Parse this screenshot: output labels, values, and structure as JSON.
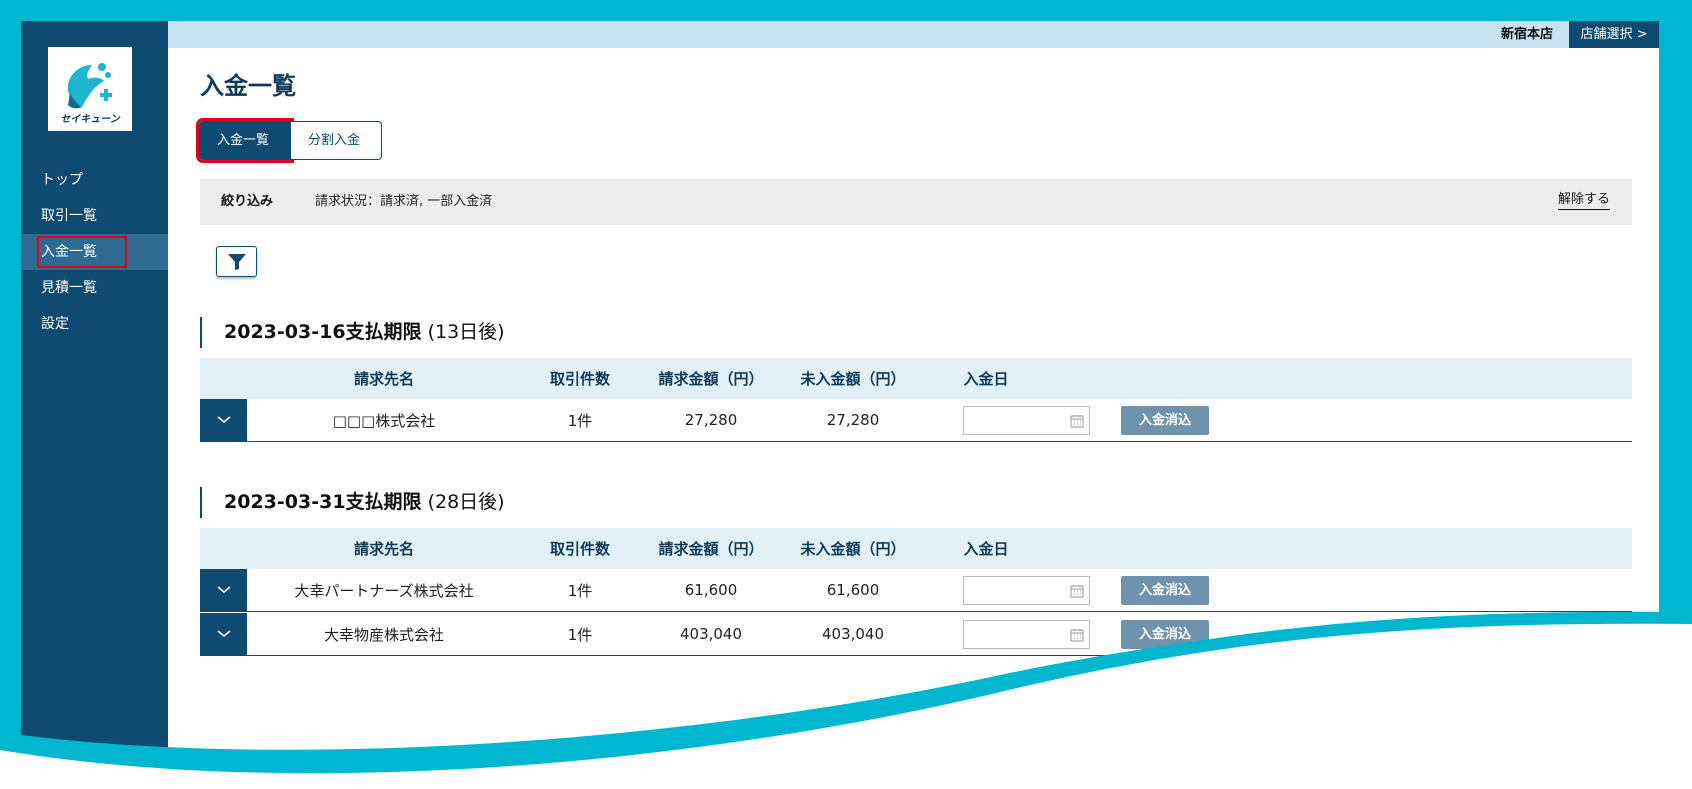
{
  "brand": {
    "logo_text": "セイキューン"
  },
  "header": {
    "store_name": "新宿本店",
    "store_select_label": "店舗選択 >"
  },
  "sidebar": {
    "items": [
      {
        "label": "トップ",
        "active": false
      },
      {
        "label": "取引一覧",
        "active": false
      },
      {
        "label": "入金一覧",
        "active": true
      },
      {
        "label": "見積一覧",
        "active": false
      },
      {
        "label": "設定",
        "active": false
      }
    ]
  },
  "page": {
    "title": "入金一覧"
  },
  "tabs": [
    {
      "label": "入金一覧",
      "active": true
    },
    {
      "label": "分割入金",
      "active": false
    }
  ],
  "filter": {
    "label": "絞り込み",
    "text": "請求状況：請求済, 一部入金済",
    "clear_label": "解除する"
  },
  "table_headers": {
    "name": "請求先名",
    "count": "取引件数",
    "billed": "請求金額（円）",
    "unpaid": "未入金額（円）",
    "date": "入金日"
  },
  "groups": [
    {
      "due": "2023-03-16支払期限",
      "relative": "(13日後)",
      "rows": [
        {
          "name": "□□□株式会社",
          "count": "1件",
          "billed": "27,280",
          "unpaid": "27,280",
          "date": "",
          "action": "入金消込"
        }
      ]
    },
    {
      "due": "2023-03-31支払期限",
      "relative": "(28日後)",
      "rows": [
        {
          "name": "大幸パートナーズ株式会社",
          "count": "1件",
          "billed": "61,600",
          "unpaid": "61,600",
          "date": "",
          "action": "入金消込"
        },
        {
          "name": "大幸物産株式会社",
          "count": "1件",
          "billed": "403,040",
          "unpaid": "403,040",
          "date": "",
          "action": "入金消込"
        }
      ]
    }
  ],
  "colors": {
    "navy": "#0f4a70",
    "frame": "#00b7cf",
    "highlight": "#e0001a",
    "header_bar": "#c6e2f1",
    "table_header": "#e2f1f8",
    "action_button": "#6f93ad"
  }
}
